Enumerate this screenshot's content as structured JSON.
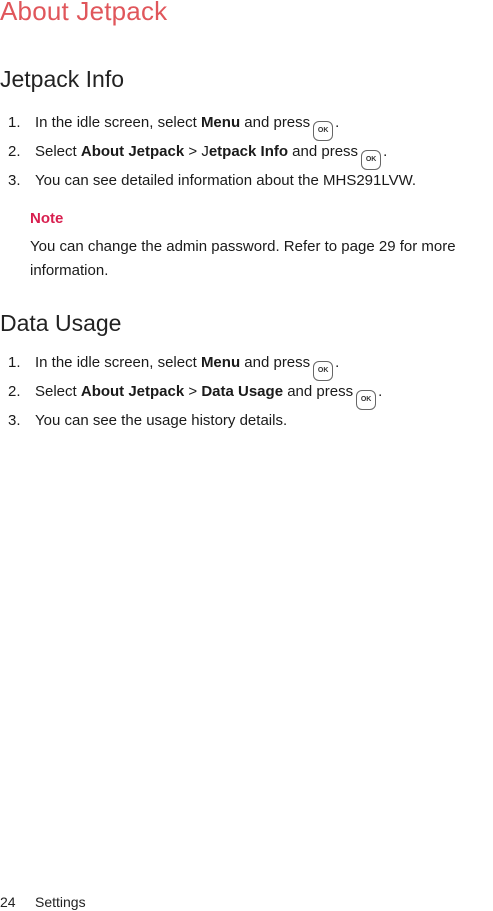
{
  "title": "About Jetpack",
  "sections": [
    {
      "heading": "Jetpack Info",
      "steps": [
        {
          "num": "1.",
          "before": "In the idle screen, select ",
          "bold1": "Menu",
          "after": " and press",
          "end": "."
        },
        {
          "num": "2.",
          "before": "Select ",
          "bold1": "About Jetpack",
          "sep": " > J",
          "bold2": "etpack Info",
          "after": " and press",
          "end": "."
        },
        {
          "num": "3.",
          "text": "You can see detailed information about the MHS291LVW."
        }
      ],
      "note": {
        "label": "Note",
        "body": "You can change the admin password. Refer to page 29 for more information."
      }
    },
    {
      "heading": "Data Usage",
      "steps": [
        {
          "num": "1.",
          "before": "In the idle screen, select ",
          "bold1": "Menu",
          "after": " and press",
          "end": "."
        },
        {
          "num": "2.",
          "before": "Select ",
          "bold1": "About Jetpack",
          "sep": " > ",
          "bold2": "Data Usage",
          "after": " and press",
          "end": "."
        },
        {
          "num": "3.",
          "text": "You can see the usage history details."
        }
      ]
    }
  ],
  "ok_icon_label": "OK",
  "footer": {
    "page": "24",
    "section": "Settings"
  },
  "colors": {
    "title": "#e0565b",
    "note_label": "#d81f4f",
    "text": "#1a1a1a"
  }
}
